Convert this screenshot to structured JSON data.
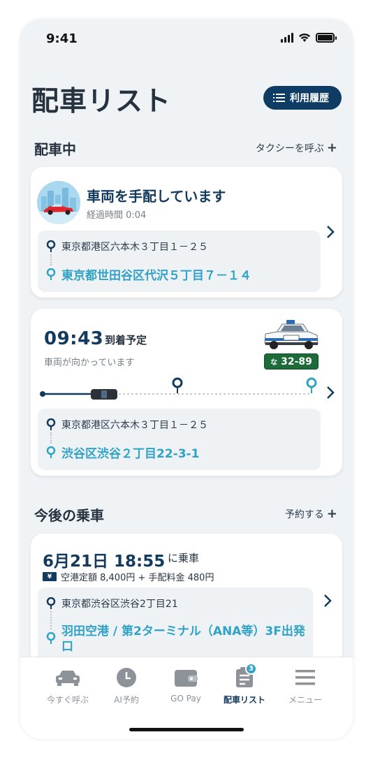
{
  "status_bar": {
    "time": "9:41"
  },
  "header": {
    "title": "配車リスト",
    "history_button": "利用履歴"
  },
  "active_section": {
    "title": "配車中",
    "action": "タクシーを呼ぶ",
    "action_plus": "+"
  },
  "card_dispatching": {
    "title": "車両を手配しています",
    "elapsed": "経過時間 0:04",
    "pickup": "東京都港区六本木３丁目１－２５",
    "destination": "東京都世田谷区代沢５丁目７－１４"
  },
  "card_approaching": {
    "eta_time": "09:43",
    "eta_label": "到着予定",
    "status": "車両が向かっています",
    "plate_kana": "な",
    "plate_number": "32-89",
    "pickup": "東京都港区六本木３丁目１－２５",
    "destination": "渋谷区渋谷２丁目22-3-1"
  },
  "upcoming_section": {
    "title": "今後の乗車",
    "action": "予約する",
    "action_plus": "+"
  },
  "card_reservation": {
    "date": "6月21日 18:55",
    "date_suffix": "に乗車",
    "yen_mark": "¥",
    "price": "空港定額 8,400円 + 手配料金 480円",
    "pickup": "東京都渋谷区渋谷2丁目21",
    "destination": "羽田空港 / 第2ターミナル（ANA等）3F出発口"
  },
  "bottom_nav": {
    "items": [
      {
        "label": "今すぐ呼ぶ",
        "icon": "car-icon"
      },
      {
        "label": "AI予約",
        "icon": "clock-icon"
      },
      {
        "label": "GO Pay",
        "icon": "wallet-icon"
      },
      {
        "label": "配車リスト",
        "icon": "list-icon",
        "badge": "3",
        "active": true
      },
      {
        "label": "メニュー",
        "icon": "menu-icon"
      }
    ]
  },
  "colors": {
    "navy": "#113a5e",
    "teal": "#2fa2c6",
    "plate_green": "#1d6b39",
    "background": "#f0f3f6"
  }
}
